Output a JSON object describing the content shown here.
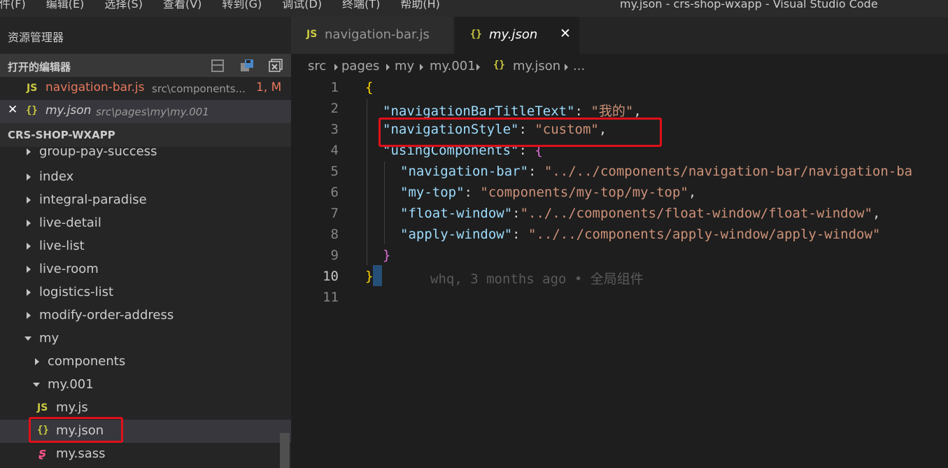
{
  "menu": [
    "件(F)",
    "编辑(E)",
    "选择(S)",
    "查看(V)",
    "转到(G)",
    "调试(D)",
    "终端(T)",
    "帮助(H)"
  ],
  "window_title": "my.json - crs-shop-wxapp - Visual Studio Code",
  "sidebar": {
    "title": "资源管理器",
    "open_editors_label": "打开的编辑器",
    "open_editors": [
      {
        "icon": "JS",
        "name": "navigation-bar.js",
        "path": "src\\components...",
        "status": "1, M"
      },
      {
        "close": "✕",
        "icon": "{}",
        "name": "my.json",
        "path": "src\\pages\\my\\my.001"
      }
    ],
    "project_label": "CRS-SHOP-WXAPP",
    "tree": [
      {
        "name": "group-pay-success"
      },
      {
        "name": "index"
      },
      {
        "name": "integral-paradise"
      },
      {
        "name": "live-detail"
      },
      {
        "name": "live-list"
      },
      {
        "name": "live-room"
      },
      {
        "name": "logistics-list"
      },
      {
        "name": "modify-order-address"
      },
      {
        "name": "my"
      },
      {
        "name": "components"
      },
      {
        "name": "my.001"
      },
      {
        "name": "my.js",
        "icon": "JS"
      },
      {
        "name": "my.json",
        "icon": "{}"
      },
      {
        "name": "my.sass",
        "icon": "ʂ"
      }
    ]
  },
  "tabs": [
    {
      "icon": "JS",
      "label": "navigation-bar.js"
    },
    {
      "icon": "{}",
      "label": "my.json",
      "close": "✕"
    }
  ],
  "breadcrumb": [
    "src",
    "pages",
    "my",
    "my.001",
    "my.json",
    "..."
  ],
  "breadcrumb_file_icon": "{}",
  "editor": {
    "line_numbers": [
      "1",
      "2",
      "3",
      "4",
      "5",
      "6",
      "7",
      "8",
      "9",
      "10",
      "11"
    ],
    "lines": {
      "l1": {
        "brace": "{"
      },
      "l2": {
        "key": "\"navigationBarTitleText\"",
        "sep": ": ",
        "val": "\"我的\"",
        "end": ","
      },
      "l3": {
        "key": "\"navigationStyle\"",
        "sep": ": ",
        "val": "\"custom\"",
        "end": ","
      },
      "l4": {
        "key": "\"usingComponents\"",
        "sep": ": ",
        "brace": "{"
      },
      "l5": {
        "key": "\"navigation-bar\"",
        "sep": ": ",
        "val": "\"../../components/navigation-bar/navigation-ba"
      },
      "l6": {
        "key": "\"my-top\"",
        "sep": ": ",
        "val": "\"components/my-top/my-top\"",
        "end": ","
      },
      "l7": {
        "key": "\"float-window\"",
        "sep": ":",
        "val": "\"../../components/float-window/float-window\"",
        "end": ","
      },
      "l8": {
        "key": "\"apply-window\"",
        "sep": ": ",
        "val": "\"../../components/apply-window/apply-window\""
      },
      "l9": {
        "brace": "}"
      },
      "l10": {
        "brace": "}"
      }
    },
    "blame": "whq, 3 months ago • 全局组件"
  },
  "colors": {
    "highlight_box": "#e0101a",
    "json_key": "#9cdcfe",
    "json_string": "#ce9178",
    "js_icon": "#cbcb41"
  }
}
